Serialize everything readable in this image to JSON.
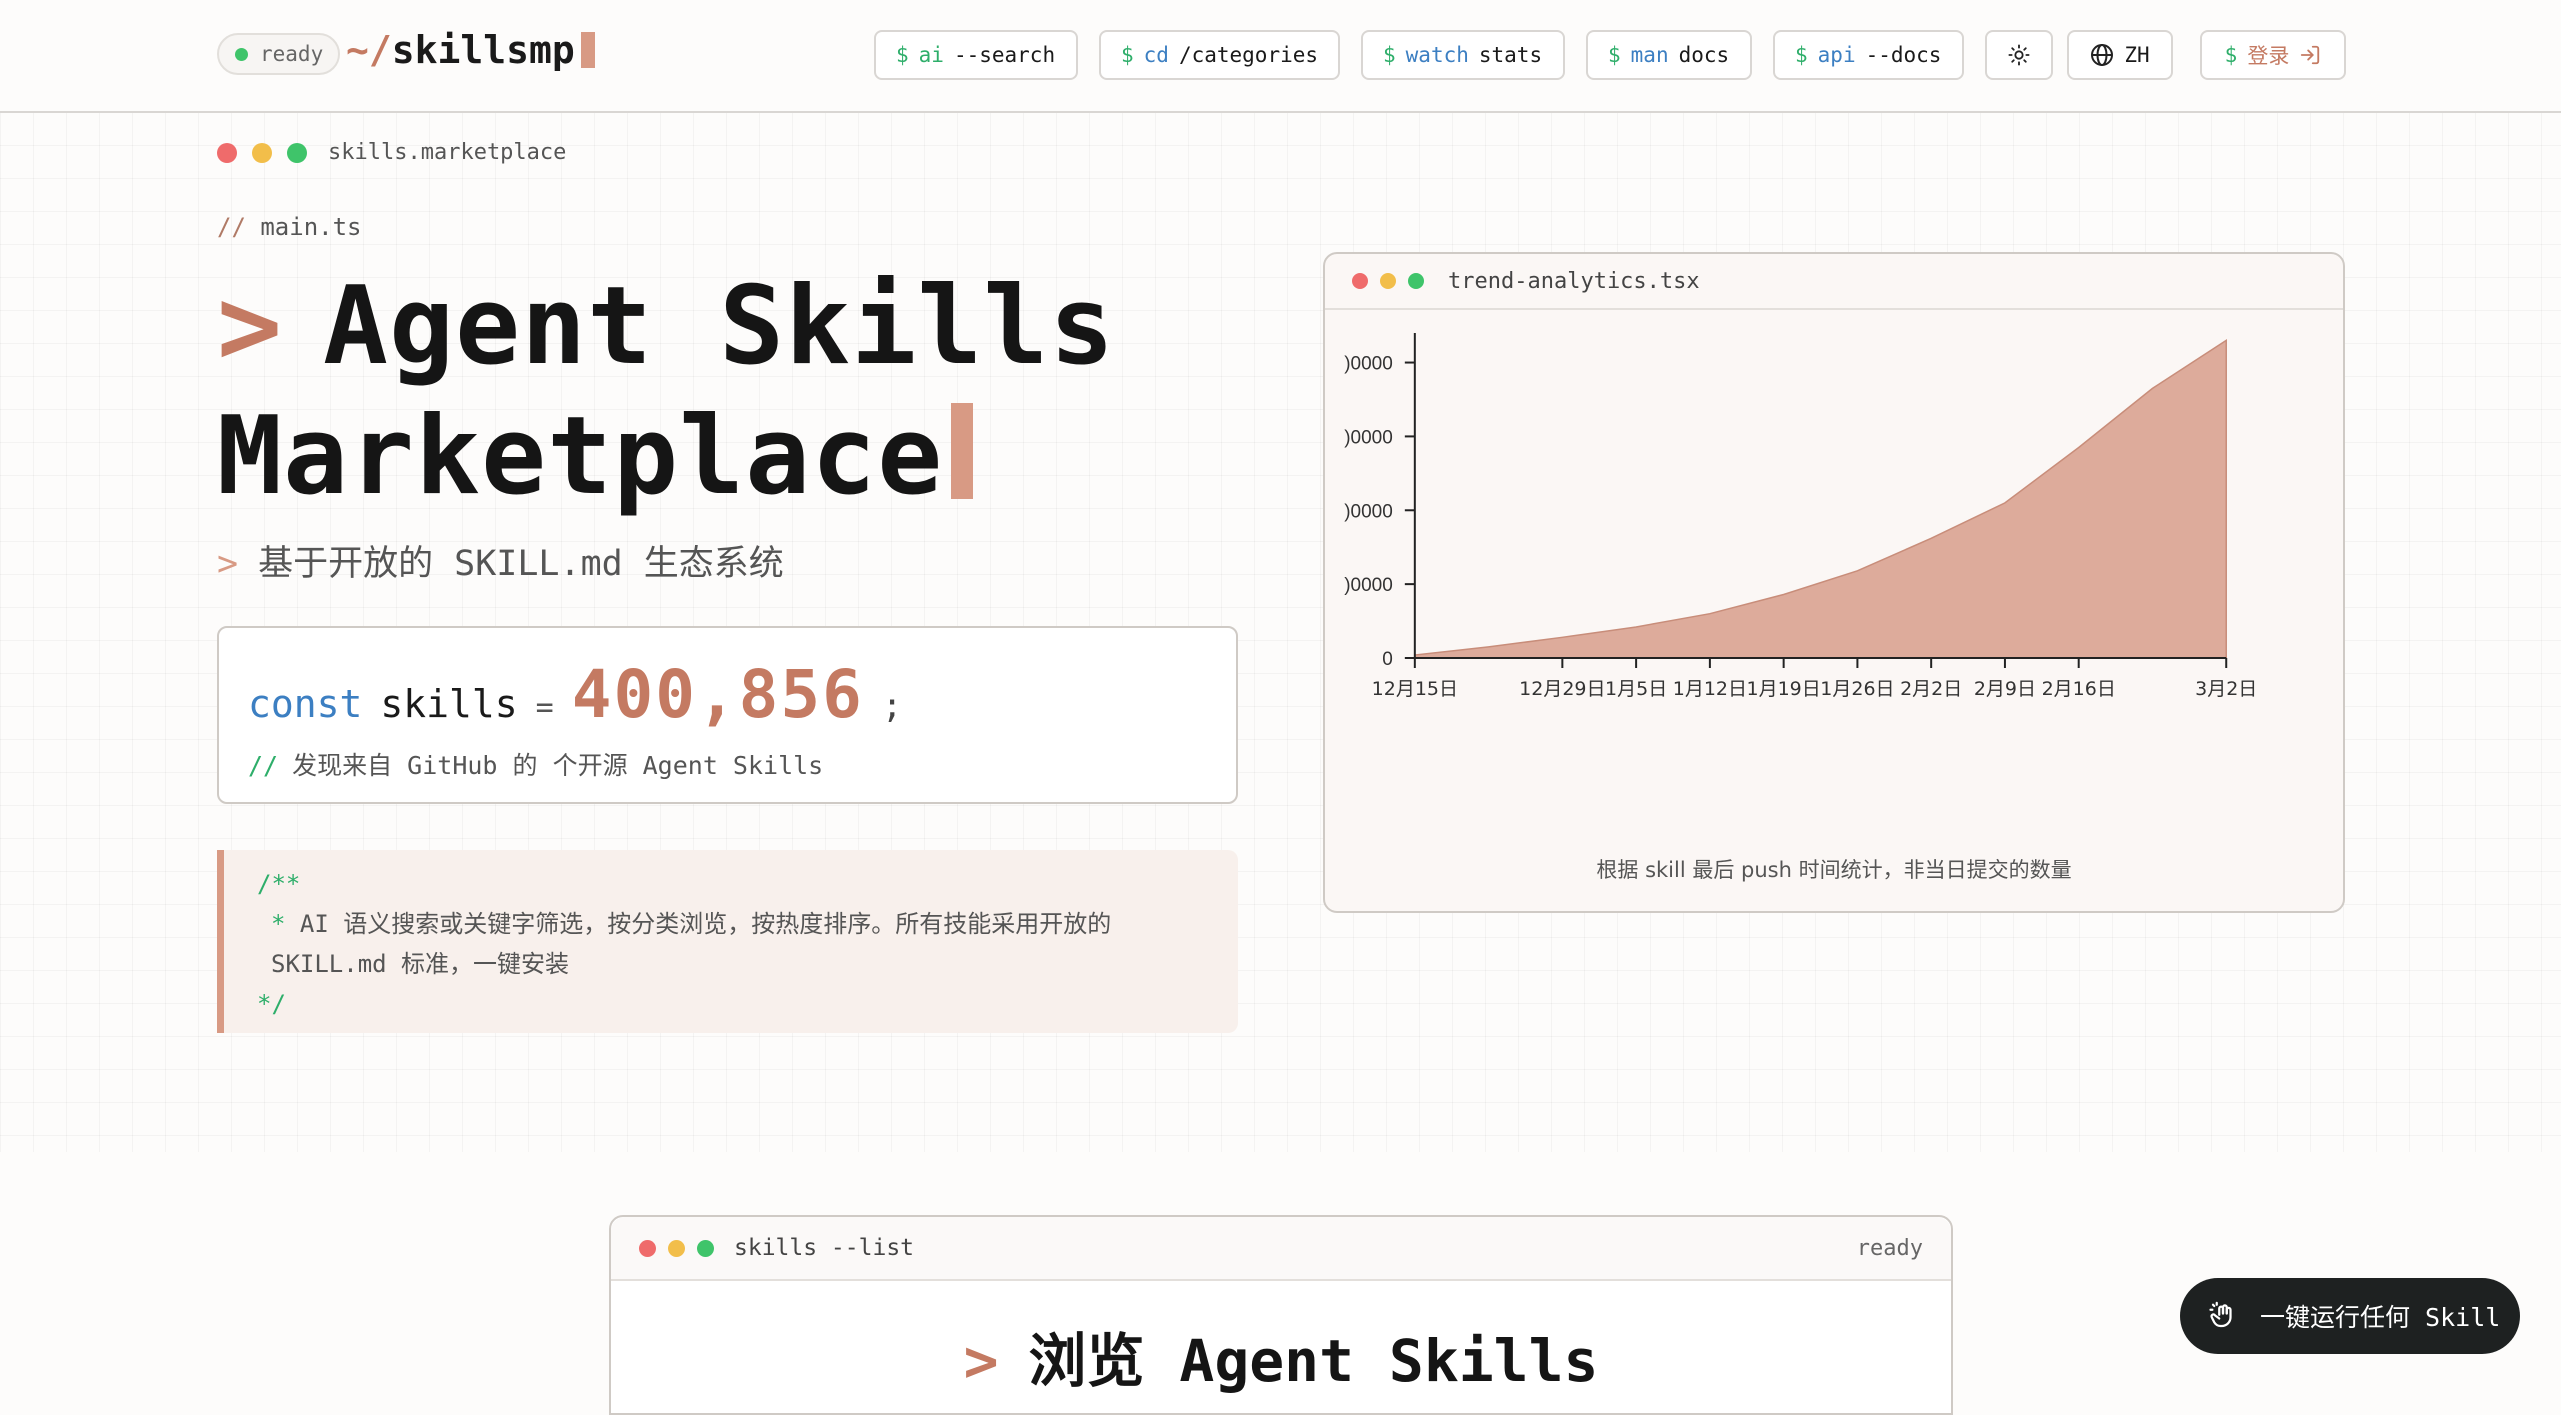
{
  "header": {
    "status": "ready",
    "logo_prefix": "~/",
    "logo_name": "skillsmp",
    "nav": [
      {
        "dollar": "$",
        "cmd": "ai",
        "arg": "--search"
      },
      {
        "dollar": "$",
        "cmd": "cd",
        "arg": "/categories"
      },
      {
        "dollar": "$",
        "cmd": "watch",
        "arg": "stats"
      },
      {
        "dollar": "$",
        "cmd": "man",
        "arg": "docs"
      },
      {
        "dollar": "$",
        "cmd": "api",
        "arg": "--docs"
      }
    ],
    "lang": "ZH",
    "login": "登录",
    "login_dollar": "$"
  },
  "hero": {
    "window_label": "skills.marketplace",
    "file_comment": "//",
    "file_name": "main.ts",
    "title_prompt": ">",
    "title_line1": "Agent Skills",
    "title_line2": "Marketplace",
    "subtitle_prompt": ">",
    "subtitle": "基于开放的 SKILL.md 生态系统",
    "code_const": "const",
    "code_var": "skills",
    "code_eq": "=",
    "skill_count": "400,856",
    "code_semi": ";",
    "code_comment_slash": "//",
    "code_comment": "发现来自 GitHub 的 个开源 Agent Skills",
    "doc_open": "/**",
    "doc_star": "*",
    "doc_line1": "AI 语义搜索或关键字筛选，按分类浏览，按热度排序。所有技能采用开放的",
    "doc_line2": "SKILL.md 标准，一键安装",
    "doc_close": "*/"
  },
  "chart_window": {
    "file_name": "trend-analytics.tsx",
    "caption": "根据 skill 最后 push 时间统计，非当日提交的数量"
  },
  "chart_data": {
    "type": "area",
    "title": "",
    "xlabel": "",
    "ylabel": "",
    "x_ticks": [
      "12月15日",
      "12月29日",
      "1月5日",
      "1月12日",
      "1月19日",
      "1月26日",
      "2月2日",
      "2月9日",
      "2月16日",
      "3月2日"
    ],
    "y_ticks": [
      "0",
      ")0000",
      ")0000",
      ")0000",
      ")0000"
    ],
    "tick_days": [
      0,
      14,
      21,
      28,
      35,
      42,
      49,
      56,
      63,
      77
    ],
    "x_days": [
      0,
      7,
      14,
      21,
      28,
      35,
      42,
      49,
      56,
      63,
      70,
      77
    ],
    "values": [
      4000,
      15000,
      28000,
      42000,
      60000,
      86000,
      118000,
      162000,
      210000,
      285000,
      365000,
      430000
    ],
    "ylim": [
      0,
      440000
    ],
    "y_tick_values": [
      0,
      100000,
      200000,
      300000,
      400000
    ],
    "color": "#dba796",
    "grid": false
  },
  "list_window": {
    "file_name": "skills --list",
    "status": "ready",
    "prompt": ">",
    "heading": "浏览 Agent Skills"
  },
  "fab": {
    "label": "一键运行任何 Skill"
  },
  "colors": {
    "accent": "#c47a62",
    "green": "#2eae6a",
    "blue": "#3c7fc2",
    "red_dot": "#ef6b6b",
    "yellow_dot": "#f2be4a",
    "green_dot": "#3fc46a"
  }
}
